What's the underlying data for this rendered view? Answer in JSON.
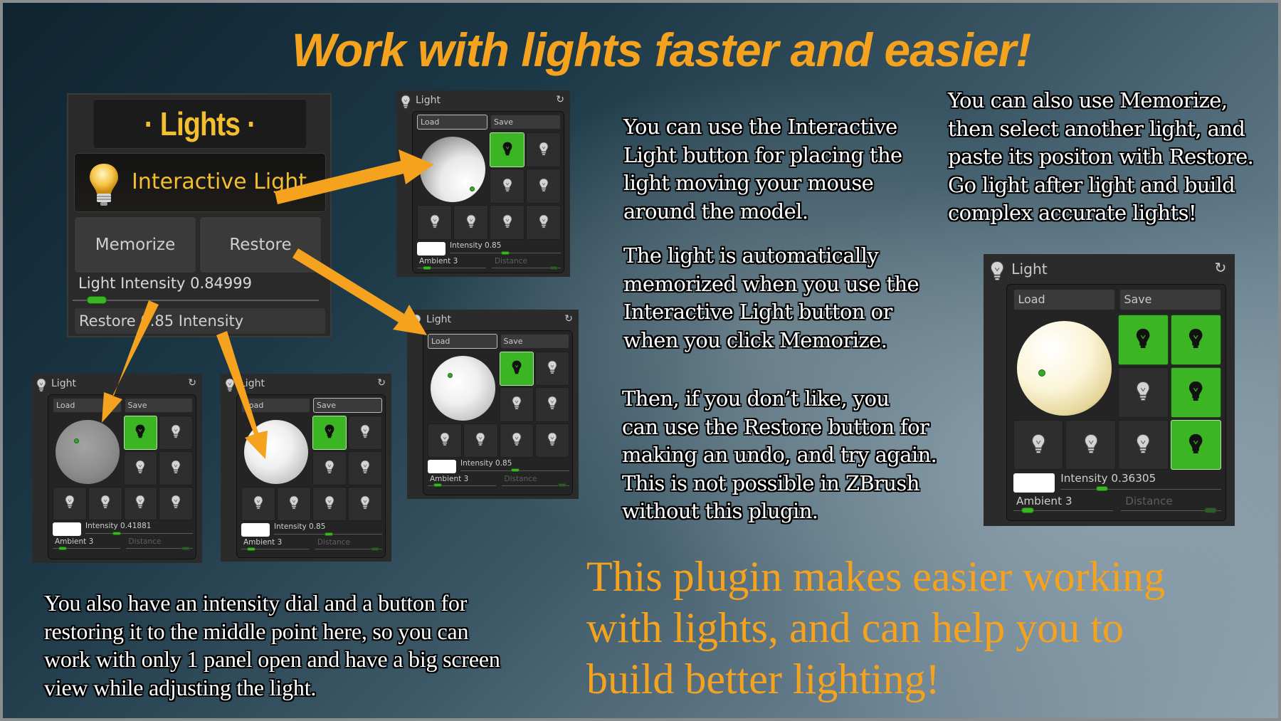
{
  "title": "Work with lights faster and easier!",
  "colors": {
    "accent_orange": "#f5a21f",
    "plugin_gold": "#f3bf2e",
    "active_green": "#3cb525",
    "panel_bg": "#2b2b2b"
  },
  "lights_plugin": {
    "header": "· Lights ·",
    "interactive_light_label": "Interactive Light",
    "memorize_label": "Memorize",
    "restore_label": "Restore",
    "intensity_label": "Light Intensity 0.84999",
    "intensity_value": 0.84999,
    "restore_intensity_label": "Restore 0.85 Intensity",
    "icons": {
      "interactive": "lightbulb-icon"
    }
  },
  "light_panels": [
    {
      "id": "top",
      "title": "Light",
      "load": "Load",
      "save": "Save",
      "intensity_label": "Intensity 0.85",
      "intensity": 0.85,
      "ambient_label": "Ambient 3",
      "distance_label": "Distance",
      "active_cells": [
        0
      ],
      "selected_cell": 0,
      "load_highlight": true,
      "save_highlight": false,
      "sphere_shade": "white-side"
    },
    {
      "id": "middle",
      "title": "Light",
      "load": "Load",
      "save": "Save",
      "intensity_label": "Intensity 0.85",
      "intensity": 0.85,
      "ambient_label": "Ambient 3",
      "distance_label": "Distance",
      "active_cells": [
        0
      ],
      "selected_cell": 0,
      "load_highlight": true,
      "save_highlight": false,
      "sphere_shade": "white"
    },
    {
      "id": "bottom-left-1",
      "title": "Light",
      "load": "Load",
      "save": "Save",
      "intensity_label": "Intensity 0.41881",
      "intensity": 0.41881,
      "ambient_label": "Ambient 3",
      "distance_label": "Distance",
      "active_cells": [
        0
      ],
      "selected_cell": 0,
      "load_highlight": false,
      "save_highlight": false,
      "sphere_shade": "grey"
    },
    {
      "id": "bottom-left-2",
      "title": "Light",
      "load": "Load",
      "save": "Save",
      "intensity_label": "Intensity 0.85",
      "intensity": 0.85,
      "ambient_label": "Ambient 3",
      "distance_label": "Distance",
      "active_cells": [
        0
      ],
      "selected_cell": 0,
      "load_highlight": false,
      "save_highlight": true,
      "sphere_shade": "white"
    },
    {
      "id": "big-right",
      "title": "Light",
      "load": "Load",
      "save": "Save",
      "intensity_label": "Intensity 0.36305",
      "intensity": 0.36305,
      "ambient_label": "Ambient 3",
      "distance_label": "Distance",
      "active_cells": [
        0,
        1,
        3,
        7
      ],
      "selected_cell": 7,
      "load_highlight": false,
      "save_highlight": false,
      "sphere_shade": "cream"
    }
  ],
  "paragraphs": {
    "interactive": [
      "You can use the Interactive",
      "Light button for placing the",
      "light moving your mouse",
      "around the model."
    ],
    "automatic": [
      "The light is automatically",
      "memorized when you use the",
      "Interactive Light button or",
      "when you click Memorize."
    ],
    "restore": [
      "Then, if you don’t like, you",
      "can use the Restore button for",
      "making an undo, and try again.",
      "This is not possible in ZBrush",
      "without this plugin."
    ],
    "memorize_also": [
      "You can also use Memorize,",
      "then select another light, and",
      "paste its positon with Restore.",
      "Go light after light and build",
      "complex accurate lights!"
    ],
    "dial": [
      "You also have an intensity dial and a button for",
      "restoring it to the middle point here, so you can",
      "work with only 1 panel open and have a big screen",
      "view while adjusting the light."
    ]
  },
  "tagline": [
    "This plugin makes easier working",
    "with lights, and can help you to",
    "build better lighting!"
  ]
}
